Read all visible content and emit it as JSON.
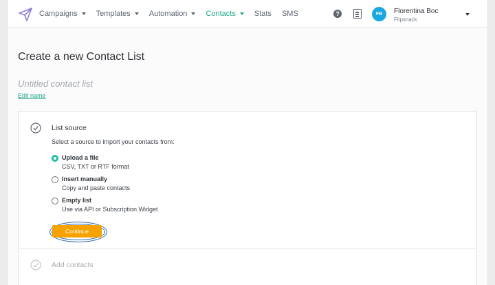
{
  "nav": {
    "items": [
      {
        "label": "Campaigns",
        "dropdown": true,
        "active": false
      },
      {
        "label": "Templates",
        "dropdown": true,
        "active": false
      },
      {
        "label": "Automation",
        "dropdown": true,
        "active": false
      },
      {
        "label": "Contacts",
        "dropdown": true,
        "active": true
      },
      {
        "label": "Stats",
        "dropdown": false,
        "active": false
      },
      {
        "label": "SMS",
        "dropdown": false,
        "active": false
      }
    ]
  },
  "header": {
    "help_icon": "?",
    "user": {
      "initials": "FB",
      "name": "Florentina Boc",
      "org": "Flipsnack"
    }
  },
  "page": {
    "title": "Create a new Contact List",
    "list_name": "Untitled contact list",
    "edit_name": "Edit name"
  },
  "steps": {
    "list_source": {
      "title": "List source",
      "description": "Select a source to import your contacts from:",
      "options": [
        {
          "label": "Upload a file",
          "sub": "CSV, TXT or RTF format",
          "checked": true
        },
        {
          "label": "Insert manually",
          "sub": "Copy and paste contacts",
          "checked": false
        },
        {
          "label": "Empty list",
          "sub": "Use via API or Subscription Widget",
          "checked": false
        }
      ],
      "continue_label": "Continue"
    },
    "add_contacts": {
      "title": "Add contacts"
    }
  },
  "colors": {
    "accent": "#1aa58a",
    "radio": "#1fbfa0",
    "button": "#f6a200",
    "avatar": "#1ba8e0",
    "highlight_ring": "#2f6bb0"
  }
}
